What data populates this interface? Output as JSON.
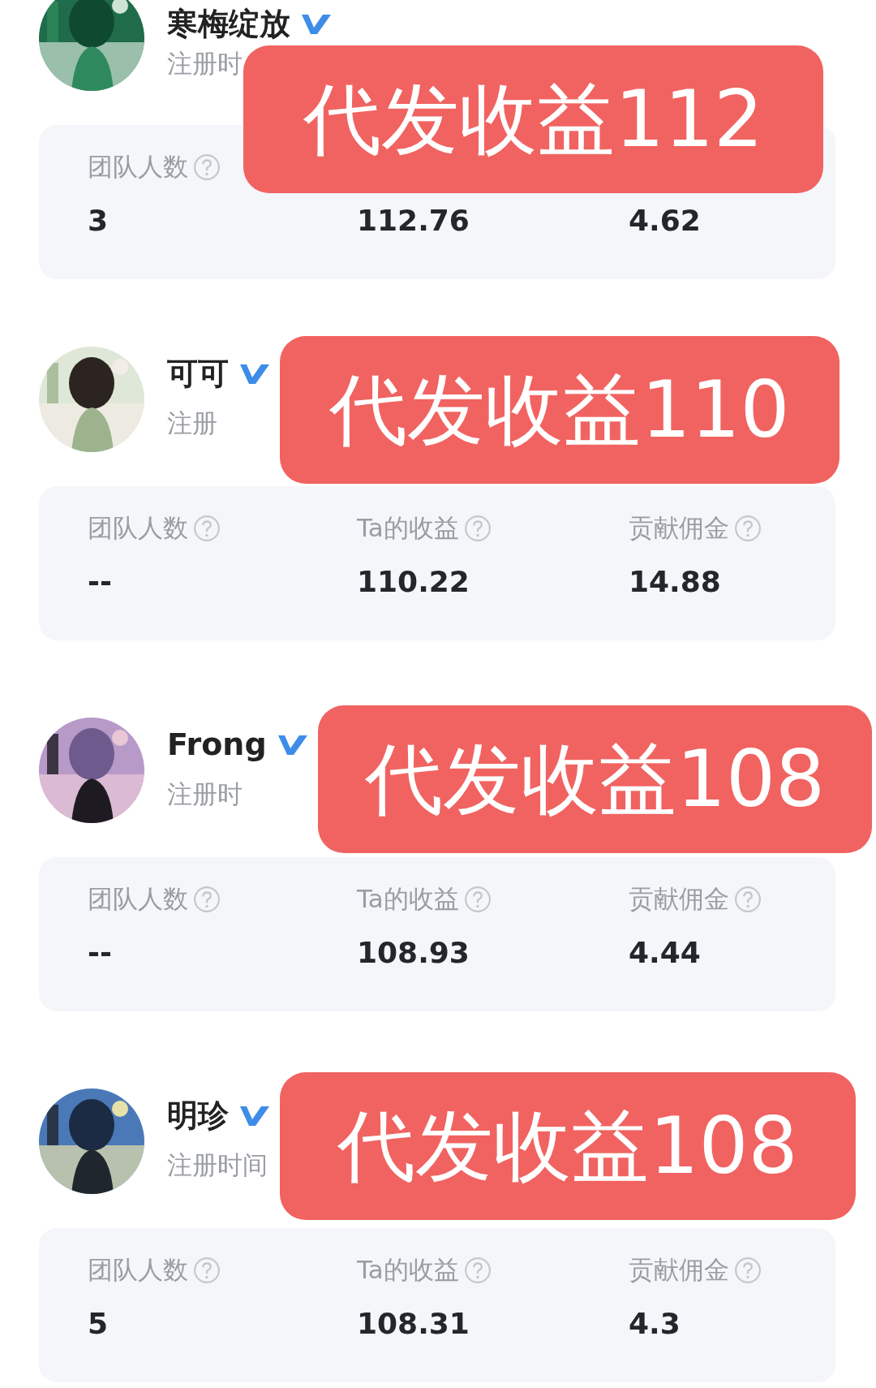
{
  "members": [
    {
      "name": "寒梅绽放",
      "registered": "注册时",
      "stats": [
        {
          "label": "团队人数",
          "value": "3"
        },
        {
          "value": "112.76"
        },
        {
          "value": "4.62"
        }
      ],
      "overlay": "代发收益112"
    },
    {
      "name": "可可",
      "registered": "注册",
      "stats": [
        {
          "label": "团队人数",
          "value": "--"
        },
        {
          "label": "Ta的收益",
          "value": "110.22"
        },
        {
          "label": "贡献佣金",
          "value": "14.88"
        }
      ],
      "overlay": "代发收益110"
    },
    {
      "name": "Frong",
      "registered": "注册时",
      "stats": [
        {
          "label": "团队人数",
          "value": "--"
        },
        {
          "label": "Ta的收益",
          "value": "108.93"
        },
        {
          "label": "贡献佣金",
          "value": "4.44"
        }
      ],
      "overlay": "代发收益108"
    },
    {
      "name": "明珍",
      "registered": "注册时间",
      "stats": [
        {
          "label": "团队人数",
          "value": "5"
        },
        {
          "label": "Ta的收益",
          "value": "108.31"
        },
        {
          "label": "贡献佣金",
          "value": "4.3"
        }
      ],
      "overlay": "代发收益108"
    }
  ]
}
